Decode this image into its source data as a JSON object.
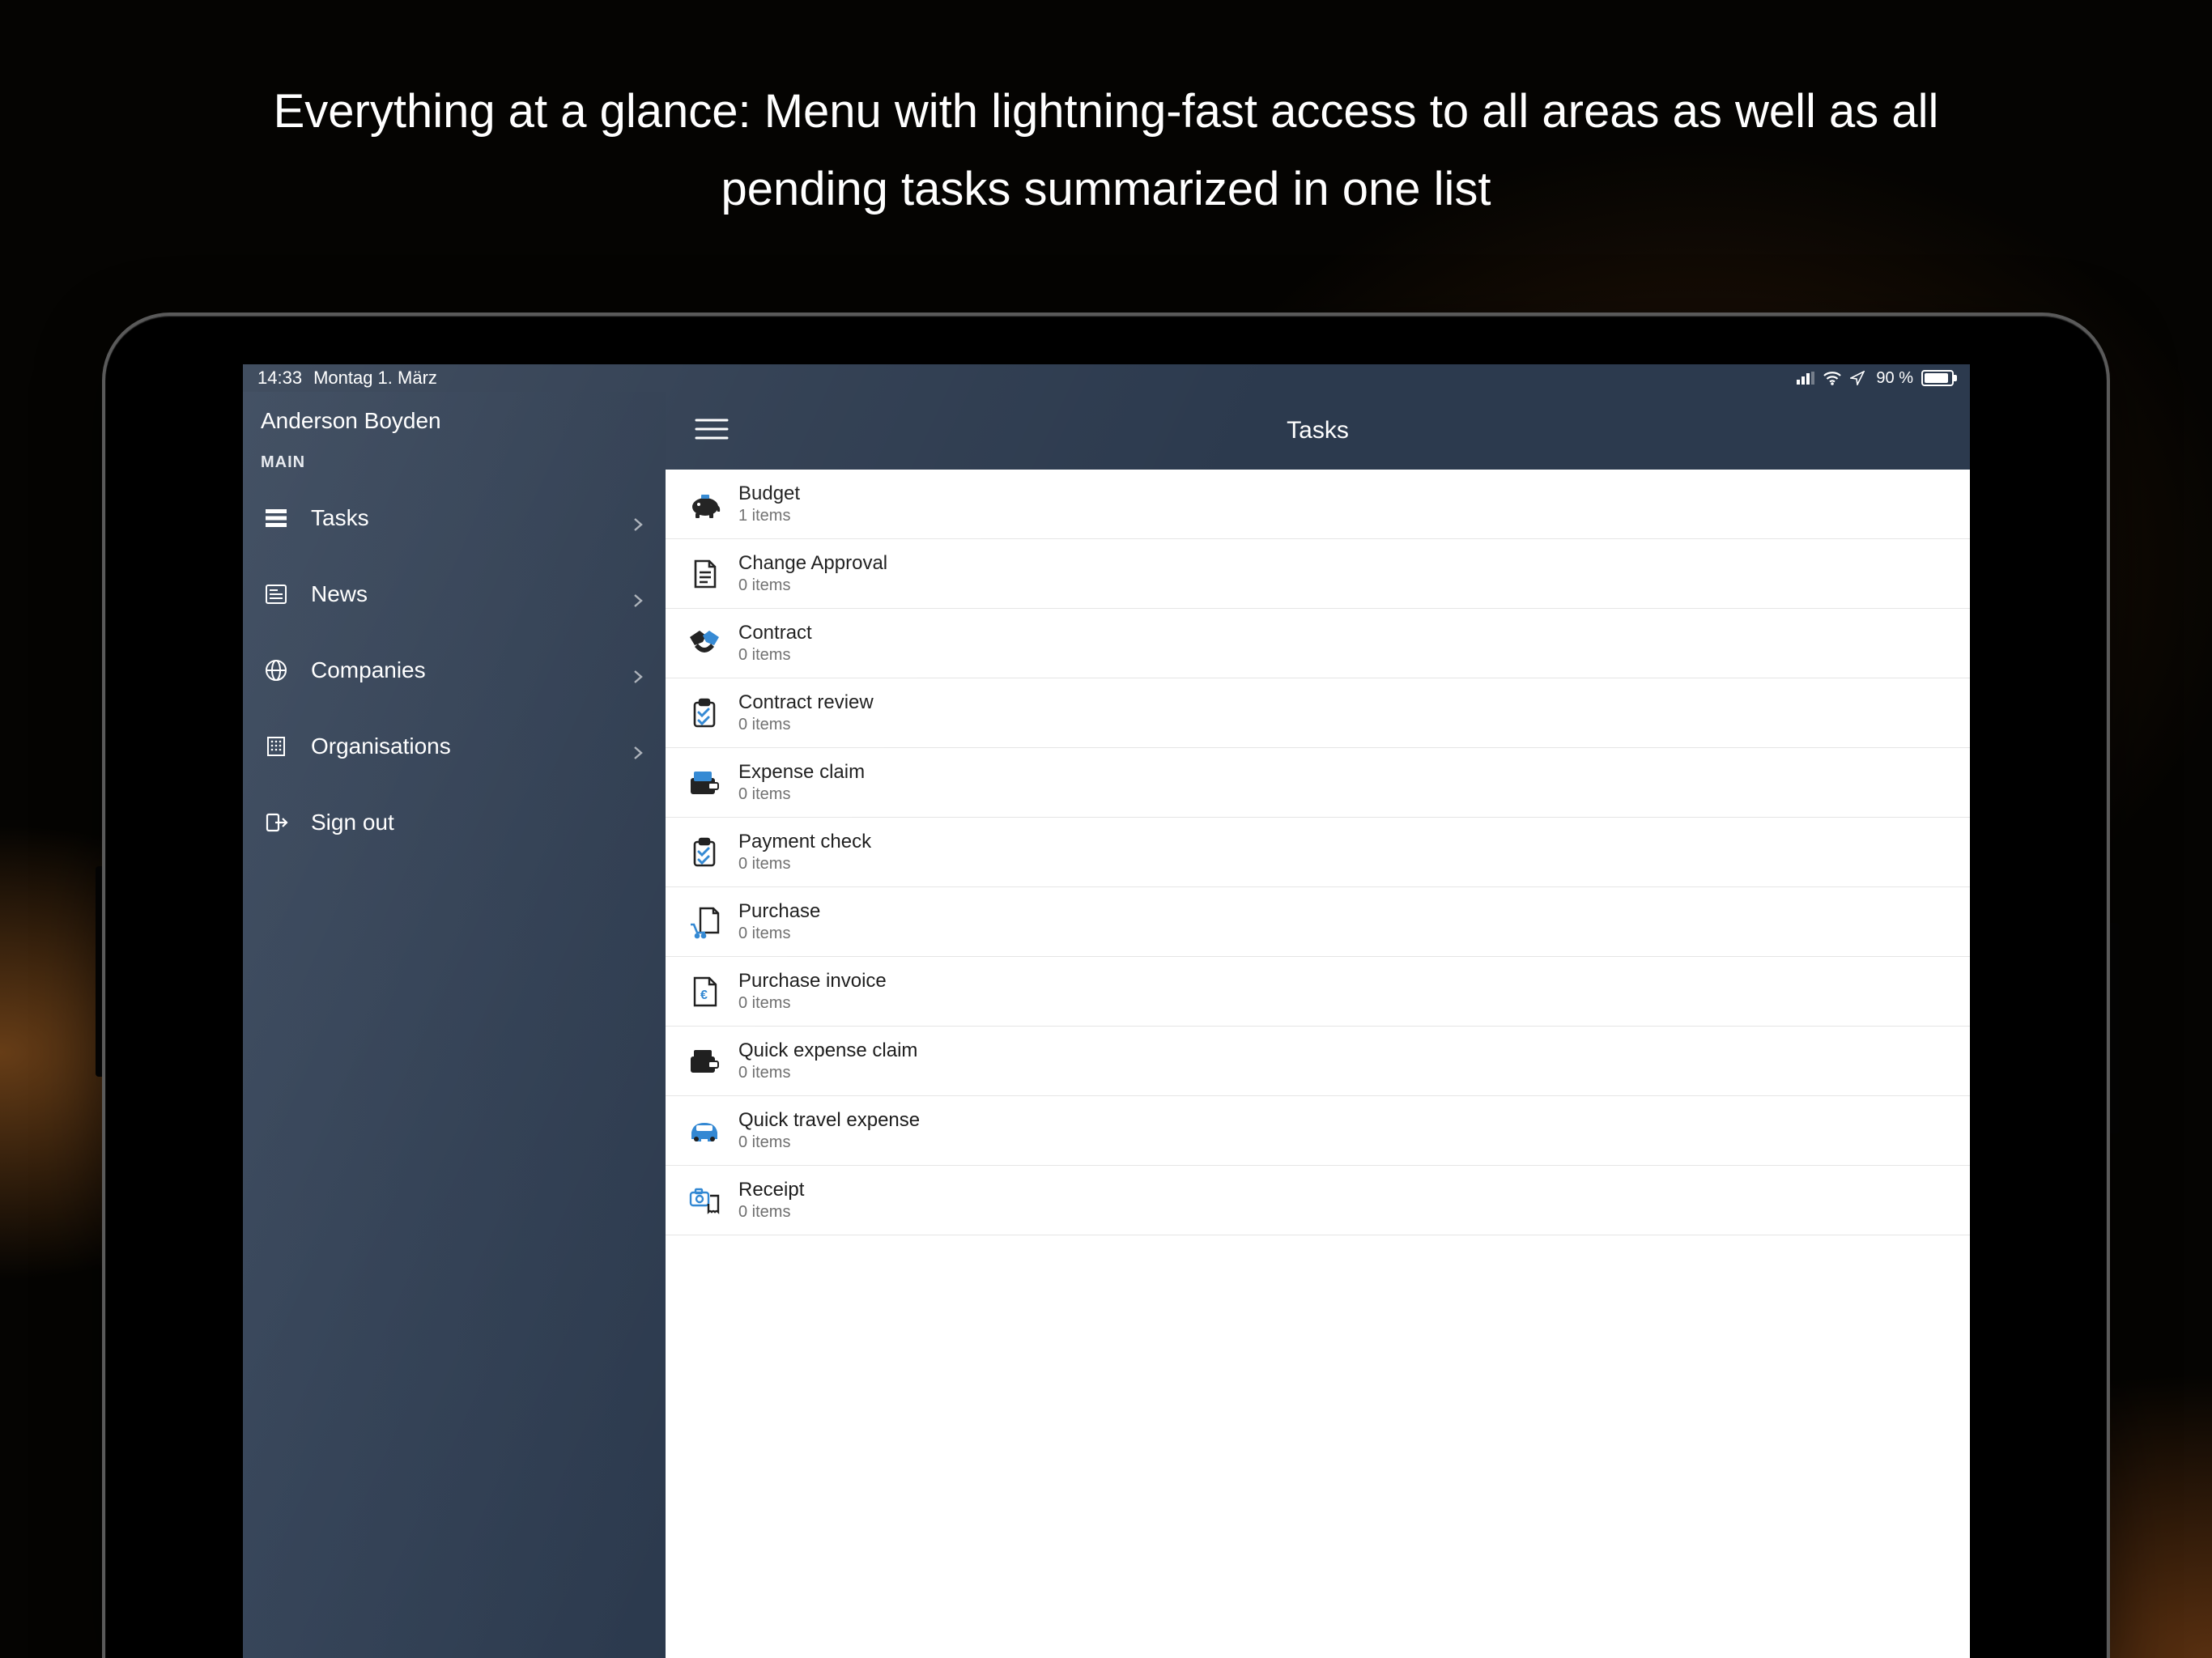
{
  "headline": "Everything at a glance: Menu with lightning-fast access to all areas as well as all pending tasks summarized in one list",
  "status": {
    "time": "14:33",
    "date": "Montag 1. März",
    "battery_pct": "90 %"
  },
  "sidebar": {
    "user": "Anderson Boyden",
    "section_label": "MAIN",
    "items": {
      "tasks": {
        "label": "Tasks"
      },
      "news": {
        "label": "News"
      },
      "companies": {
        "label": "Companies"
      },
      "orgs": {
        "label": "Organisations"
      },
      "signout": {
        "label": "Sign out"
      }
    }
  },
  "main": {
    "title": "Tasks"
  },
  "tasks": {
    "budget": {
      "title": "Budget",
      "sub": "1 items"
    },
    "change_approval": {
      "title": "Change Approval",
      "sub": "0 items"
    },
    "contract": {
      "title": "Contract",
      "sub": "0 items"
    },
    "contract_review": {
      "title": "Contract review",
      "sub": "0 items"
    },
    "expense_claim": {
      "title": "Expense claim",
      "sub": "0 items"
    },
    "payment_check": {
      "title": "Payment check",
      "sub": "0 items"
    },
    "purchase": {
      "title": "Purchase",
      "sub": "0 items"
    },
    "purchase_invoice": {
      "title": "Purchase invoice",
      "sub": "0 items"
    },
    "quick_expense": {
      "title": "Quick expense claim",
      "sub": "0 items"
    },
    "quick_travel": {
      "title": "Quick travel expense",
      "sub": "0 items"
    },
    "receipt": {
      "title": "Receipt",
      "sub": "0 items"
    }
  },
  "colors": {
    "accent_blue": "#2f86d2",
    "panel_navy": "#2c3a4e"
  }
}
